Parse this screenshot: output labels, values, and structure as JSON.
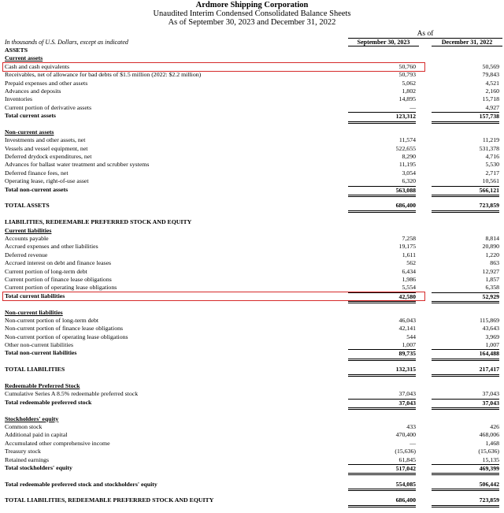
{
  "header": {
    "company": "Ardmore Shipping Corporation",
    "statement": "Unaudited Interim Condensed Consolidated Balance Sheets",
    "dates": "As of September 30, 2023 and December 31, 2022"
  },
  "columns": {
    "as_of": "As of",
    "col1": "September 30, 2023",
    "col2": "December 31, 2022",
    "unit_note": "In thousands of U.S. Dollars, except as indicated"
  },
  "highlight_color": "#d62b2b",
  "rows": [
    {
      "label": "ASSETS",
      "v1": "",
      "v2": "",
      "style": "section"
    },
    {
      "label": "Current assets",
      "v1": "",
      "v2": "",
      "style": "section ul"
    },
    {
      "label": "Cash and cash equivalents",
      "v1": "50,760",
      "v2": "50,569",
      "style": "",
      "highlight": true
    },
    {
      "label": "Receivables, net of allowance for bad debts of $1.5 million (2022: $2.2 million)",
      "v1": "50,793",
      "v2": "79,843",
      "style": ""
    },
    {
      "label": "Prepaid expenses and other assets",
      "v1": "5,062",
      "v2": "4,521",
      "style": ""
    },
    {
      "label": "Advances and deposits",
      "v1": "1,802",
      "v2": "2,160",
      "style": ""
    },
    {
      "label": "Inventories",
      "v1": "14,895",
      "v2": "15,718",
      "style": ""
    },
    {
      "label": "Current portion of derivative assets",
      "v1": "—",
      "v2": "4,927",
      "style": ""
    },
    {
      "label": "Total current assets",
      "v1": "123,312",
      "v2": "157,738",
      "style": "b t dbl"
    },
    {
      "label": "",
      "v1": "",
      "v2": "",
      "style": "sp"
    },
    {
      "label": "Non-current assets",
      "v1": "",
      "v2": "",
      "style": "section ul"
    },
    {
      "label": "Investments and other assets, net",
      "v1": "11,574",
      "v2": "11,219",
      "style": ""
    },
    {
      "label": "Vessels and vessel equipment, net",
      "v1": "522,655",
      "v2": "531,378",
      "style": ""
    },
    {
      "label": "Deferred drydock expenditures, net",
      "v1": "8,290",
      "v2": "4,716",
      "style": ""
    },
    {
      "label": "Advances for ballast water treatment and scrubber systems",
      "v1": "11,195",
      "v2": "5,530",
      "style": ""
    },
    {
      "label": "Deferred finance fees, net",
      "v1": "3,054",
      "v2": "2,717",
      "style": ""
    },
    {
      "label": "Operating lease, right-of-use asset",
      "v1": "6,320",
      "v2": "10,561",
      "style": ""
    },
    {
      "label": "Total non-current assets",
      "v1": "563,088",
      "v2": "566,121",
      "style": "b t dbl"
    },
    {
      "label": "",
      "v1": "",
      "v2": "",
      "style": "sp"
    },
    {
      "label": "TOTAL ASSETS",
      "v1": "686,400",
      "v2": "723,859",
      "style": "b dbl"
    },
    {
      "label": "",
      "v1": "",
      "v2": "",
      "style": "sp"
    },
    {
      "label": "LIABILITIES, REDEEMABLE PREFERRED STOCK AND EQUITY",
      "v1": "",
      "v2": "",
      "style": "section"
    },
    {
      "label": "Current liabilities",
      "v1": "",
      "v2": "",
      "style": "section ul"
    },
    {
      "label": "Accounts payable",
      "v1": "7,258",
      "v2": "8,814",
      "style": ""
    },
    {
      "label": "Accrued expenses and other liabilities",
      "v1": "19,175",
      "v2": "20,890",
      "style": ""
    },
    {
      "label": "Deferred revenue",
      "v1": "1,611",
      "v2": "1,220",
      "style": ""
    },
    {
      "label": "Accrued interest on debt and finance leases",
      "v1": "562",
      "v2": "863",
      "style": ""
    },
    {
      "label": "Current portion of long-term debt",
      "v1": "6,434",
      "v2": "12,927",
      "style": ""
    },
    {
      "label": "Current portion of finance lease obligations",
      "v1": "1,986",
      "v2": "1,857",
      "style": ""
    },
    {
      "label": "Current portion of operating lease obligations",
      "v1": "5,554",
      "v2": "6,358",
      "style": ""
    },
    {
      "label": "Total current liabilities",
      "v1": "42,580",
      "v2": "52,929",
      "style": "b t dbl",
      "highlight": true
    },
    {
      "label": "",
      "v1": "",
      "v2": "",
      "style": "sp"
    },
    {
      "label": "Non-current liabilities",
      "v1": "",
      "v2": "",
      "style": "section ul"
    },
    {
      "label": "Non-current portion of long-term debt",
      "v1": "46,043",
      "v2": "115,869",
      "style": ""
    },
    {
      "label": "Non-current portion of finance lease obligations",
      "v1": "42,141",
      "v2": "43,643",
      "style": ""
    },
    {
      "label": "Non-current portion of operating lease obligations",
      "v1": "544",
      "v2": "3,969",
      "style": ""
    },
    {
      "label": "Other non-current liabilities",
      "v1": "1,007",
      "v2": "1,007",
      "style": ""
    },
    {
      "label": "Total non-current liabilities",
      "v1": "89,735",
      "v2": "164,488",
      "style": "b t dbl"
    },
    {
      "label": "",
      "v1": "",
      "v2": "",
      "style": "sp"
    },
    {
      "label": "TOTAL LIABILITIES",
      "v1": "132,315",
      "v2": "217,417",
      "style": "b dbl"
    },
    {
      "label": "",
      "v1": "",
      "v2": "",
      "style": "sp"
    },
    {
      "label": "Redeemable Preferred Stock",
      "v1": "",
      "v2": "",
      "style": "section ul"
    },
    {
      "label": "Cumulative Series A 8.5% redeemable preferred stock",
      "v1": "37,043",
      "v2": "37,043",
      "style": ""
    },
    {
      "label": "Total redeemable preferred stock",
      "v1": "37,043",
      "v2": "37,043",
      "style": "b t dbl"
    },
    {
      "label": "",
      "v1": "",
      "v2": "",
      "style": "sp"
    },
    {
      "label": "Stockholders' equity",
      "v1": "",
      "v2": "",
      "style": "section ul"
    },
    {
      "label": "Common stock",
      "v1": "433",
      "v2": "426",
      "style": ""
    },
    {
      "label": "Additional paid in capital",
      "v1": "470,400",
      "v2": "468,006",
      "style": ""
    },
    {
      "label": "Accumulated other comprehensive income",
      "v1": "—",
      "v2": "1,468",
      "style": ""
    },
    {
      "label": "Treasury stock",
      "v1": "(15,636)",
      "v2": "(15,636)",
      "style": ""
    },
    {
      "label": "Retained earnings",
      "v1": "61,845",
      "v2": "15,135",
      "style": ""
    },
    {
      "label": "Total stockholders' equity",
      "v1": "517,042",
      "v2": "469,399",
      "style": "b t dbl"
    },
    {
      "label": "",
      "v1": "",
      "v2": "",
      "style": "sp"
    },
    {
      "label": "Total redeemable preferred stock and stockholders' equity",
      "v1": "554,085",
      "v2": "506,442",
      "style": "b dbl"
    },
    {
      "label": "",
      "v1": "",
      "v2": "",
      "style": "sp"
    },
    {
      "label": "TOTAL LIABILITIES, REDEEMABLE PREFERRED STOCK AND EQUITY",
      "v1": "686,400",
      "v2": "723,859",
      "style": "b dbl"
    }
  ]
}
